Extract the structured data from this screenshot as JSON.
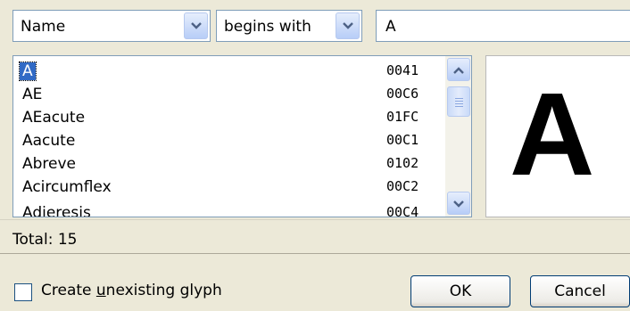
{
  "filter": {
    "field_value": "Name",
    "operator_value": "begins with",
    "search_value": "A"
  },
  "glyph_list": {
    "items": [
      {
        "name": "A",
        "code": "0041",
        "selected": true
      },
      {
        "name": "AE",
        "code": "00C6"
      },
      {
        "name": "AEacute",
        "code": "01FC"
      },
      {
        "name": "Aacute",
        "code": "00C1"
      },
      {
        "name": "Abreve",
        "code": "0102"
      },
      {
        "name": "Acircumflex",
        "code": "00C2"
      },
      {
        "name": "Adieresis",
        "code": "00C4"
      }
    ]
  },
  "preview": {
    "glyph": "A"
  },
  "status": {
    "total_label": "Total: 15"
  },
  "footer": {
    "checkbox_label_before": "Create ",
    "checkbox_label_mnemonic": "u",
    "checkbox_label_after": "nexisting glyph",
    "checkbox_checked": false,
    "ok_label": "OK",
    "cancel_label": "Cancel"
  },
  "colors": {
    "selection": "#316ac5",
    "dialog_bg": "#ece9d8",
    "border": "#7f9db9"
  }
}
